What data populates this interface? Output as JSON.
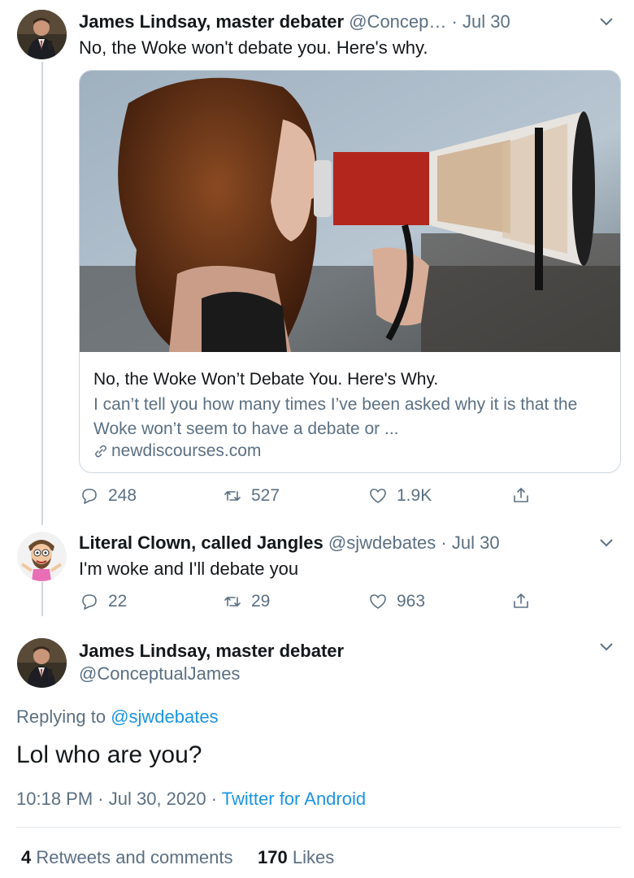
{
  "tweet1": {
    "name": "James Lindsay, master debater",
    "handle": "@Concep…",
    "dot": "·",
    "date": "Jul 30",
    "text": "No, the Woke won't debate you. Here's why.",
    "card": {
      "title": "No, the Woke Won’t Debate You. Here's Why.",
      "description": "I can’t tell you how many times I’ve been asked why it is that the Woke won’t seem to have a debate or ...",
      "domain": "newdiscourses.com",
      "domain_icon": "link-icon"
    },
    "replies": "248",
    "retweets": "527",
    "likes": "1.9K"
  },
  "tweet2": {
    "name": "Literal Clown, called Jangles",
    "handle": "@sjwdebates",
    "dot": "·",
    "date": "Jul 30",
    "text": "I'm woke and I'll debate you",
    "replies": "22",
    "retweets": "29",
    "likes": "963"
  },
  "tweet3": {
    "name": "James Lindsay, master debater",
    "handle": "@ConceptualJames",
    "replying_prefix": "Replying to",
    "replying_mention": "@sjwdebates",
    "text": "Lol who are you?",
    "time": "10:18 PM",
    "date": "Jul 30, 2020",
    "dot": "·",
    "source": "Twitter for Android",
    "retweet_count": "4",
    "retweet_label": "Retweets and comments",
    "like_count": "170",
    "like_label": "Likes"
  },
  "colors": {
    "link": "#1b95e0",
    "secondary": "#5b7083",
    "thread_line": "#ccd6dd"
  }
}
